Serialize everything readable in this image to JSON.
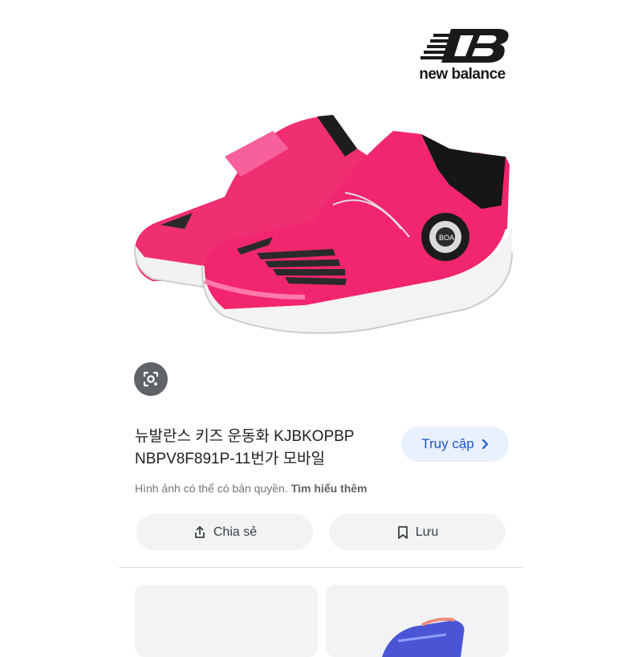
{
  "brand": {
    "name": "new balance"
  },
  "result": {
    "title_line1": "뉴발란스 키즈 운동화 KJBKOPBP",
    "title_line2": "NBPV8F891P-11번가 모바일",
    "visit_label": "Truy cập",
    "copyright_text": "Hình ảnh có thể có bản quyền.",
    "learn_more": "Tìm hiểu thêm",
    "share_label": "Chia sẻ",
    "save_label": "Lưu"
  },
  "icons": {
    "lens": "google-lens-icon",
    "visit": "chevron-right-icon",
    "share": "share-icon",
    "save": "bookmark-icon"
  },
  "colors": {
    "accent": "#1a58c4",
    "visit_bg": "#e8f0fe",
    "pill_bg": "#f1f3f4",
    "shoe_pink": "#f0246e"
  }
}
